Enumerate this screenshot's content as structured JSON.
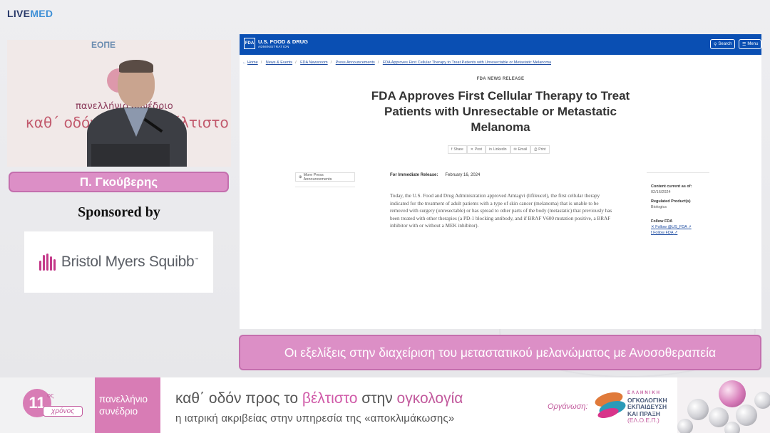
{
  "app": {
    "logo_live": "LIVE",
    "logo_med": "MED"
  },
  "speaker": {
    "name": "Π. Γκούβερης"
  },
  "sponsor": {
    "heading": "Sponsored by",
    "name": "Bristol Myers Squibb",
    "trademark": "™"
  },
  "video": {
    "backdrop_org": "ΕΟΠΕ",
    "backdrop_line1": "πανελλήνιο συνέδριο",
    "backdrop_line2": "καθ΄ οδόν προς το βέλτιστο"
  },
  "browser": {
    "brand_line1": "U.S. FOOD & DRUG",
    "brand_line2": "ADMINISTRATION",
    "logo_box": "FDA",
    "search_label": "Search",
    "menu_label": "Menu",
    "breadcrumbs": [
      "Home",
      "News & Events",
      "FDA Newsroom",
      "Press Announcements",
      "FDA Approves First Cellular Therapy to Treat Patients with Unresectable or Metastatic Melanoma"
    ],
    "kicker": "FDA NEWS RELEASE",
    "headline": "FDA Approves First Cellular Therapy to Treat Patients with Unresectable or Metastatic Melanoma",
    "share": [
      "Share",
      "Post",
      "Linkedin",
      "Email",
      "Print"
    ],
    "more_press": "More Press Announcements",
    "release_label": "For Immediate Release:",
    "release_date": "February 16, 2024",
    "body": "Today, the U.S. Food and Drug Administration approved Amtagvi (lifileucel), the first cellular therapy indicated for the treatment of adult patients with a type of skin cancer (melanoma) that is unable to be removed with surgery (unresectable) or has spread to other parts of the body (metastatic) that previously has been treated with other therapies (a PD-1 blocking antibody, and if BRAF V600 mutation positive, a BRAF inhibitor with or without a MEK inhibitor).",
    "side": {
      "content_current_label": "Content current as of:",
      "content_current_value": "02/16/2024",
      "regulated_label": "Regulated Product(s)",
      "regulated_value": "Biologics",
      "follow_label": "Follow FDA",
      "follow_x": "Follow @US_FDA",
      "follow_fb": "Follow FDA"
    }
  },
  "lecture_title": "Οι εξελίξεις στην διαχείριση του μεταστατικού μελανώματος με Ανοσοθεραπεία",
  "banner": {
    "edition_number": "11",
    "edition_suffix": "ος",
    "edition_word": "χρόνος",
    "congress_line1": "πανελλήνιο",
    "congress_line2": "συνέδριο",
    "slogan_part1": "καθ΄ οδόν προς το ",
    "slogan_highlight1": "βέλτιστο",
    "slogan_part2": " στην ",
    "slogan_highlight2": "ογκολογία",
    "subtitle": "η ιατρική ακριβείας στην υπηρεσία της «αποκλιμάκωσης»",
    "organizer_label": "Οργάνωση:",
    "org_top": "ΕΛΛΗΝΙΚΗ",
    "org_line1": "ΟΓΚΟΛΟΓΙΚΗ",
    "org_line2": "ΕΚΠΑΙΔΕΥΣΗ",
    "org_line3": "ΚΑΙ ΠΡΑΞΗ",
    "org_abbr": "(ΕΛ.Ο.Ε.Π.)"
  },
  "colors": {
    "accent_pink": "#dc8fc6",
    "fda_blue": "#0a4fb3",
    "live_navy": "#2a3a6a",
    "med_blue": "#3d8fd6"
  }
}
